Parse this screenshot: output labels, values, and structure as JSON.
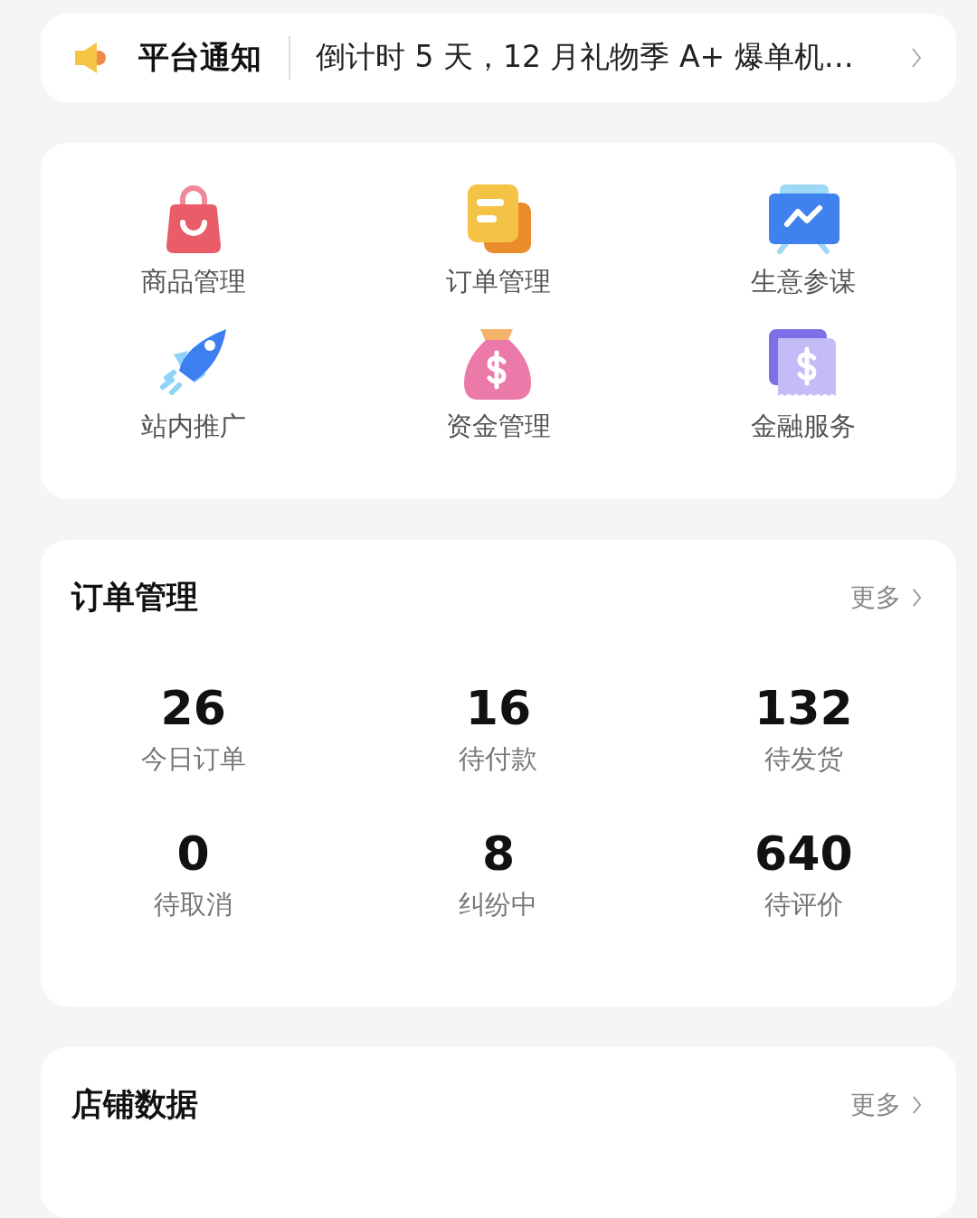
{
  "notice": {
    "title": "平台通知",
    "text": "倒计时 5 天，12 月礼物季 A+ 爆单机…"
  },
  "shortcuts": [
    {
      "kind": "bag",
      "label": "商品管理"
    },
    {
      "kind": "docs",
      "label": "订单管理"
    },
    {
      "kind": "chart",
      "label": "生意参谋"
    },
    {
      "kind": "rocket",
      "label": "站内推广"
    },
    {
      "kind": "moneybag",
      "label": "资金管理"
    },
    {
      "kind": "finance",
      "label": "金融服务"
    }
  ],
  "orders": {
    "title": "订单管理",
    "more": "更多",
    "stats": [
      {
        "value": "26",
        "label": "今日订单"
      },
      {
        "value": "16",
        "label": "待付款"
      },
      {
        "value": "132",
        "label": "待发货"
      },
      {
        "value": "0",
        "label": "待取消"
      },
      {
        "value": "8",
        "label": "纠纷中"
      },
      {
        "value": "640",
        "label": "待评价"
      }
    ]
  },
  "store": {
    "title": "店铺数据",
    "more": "更多"
  }
}
